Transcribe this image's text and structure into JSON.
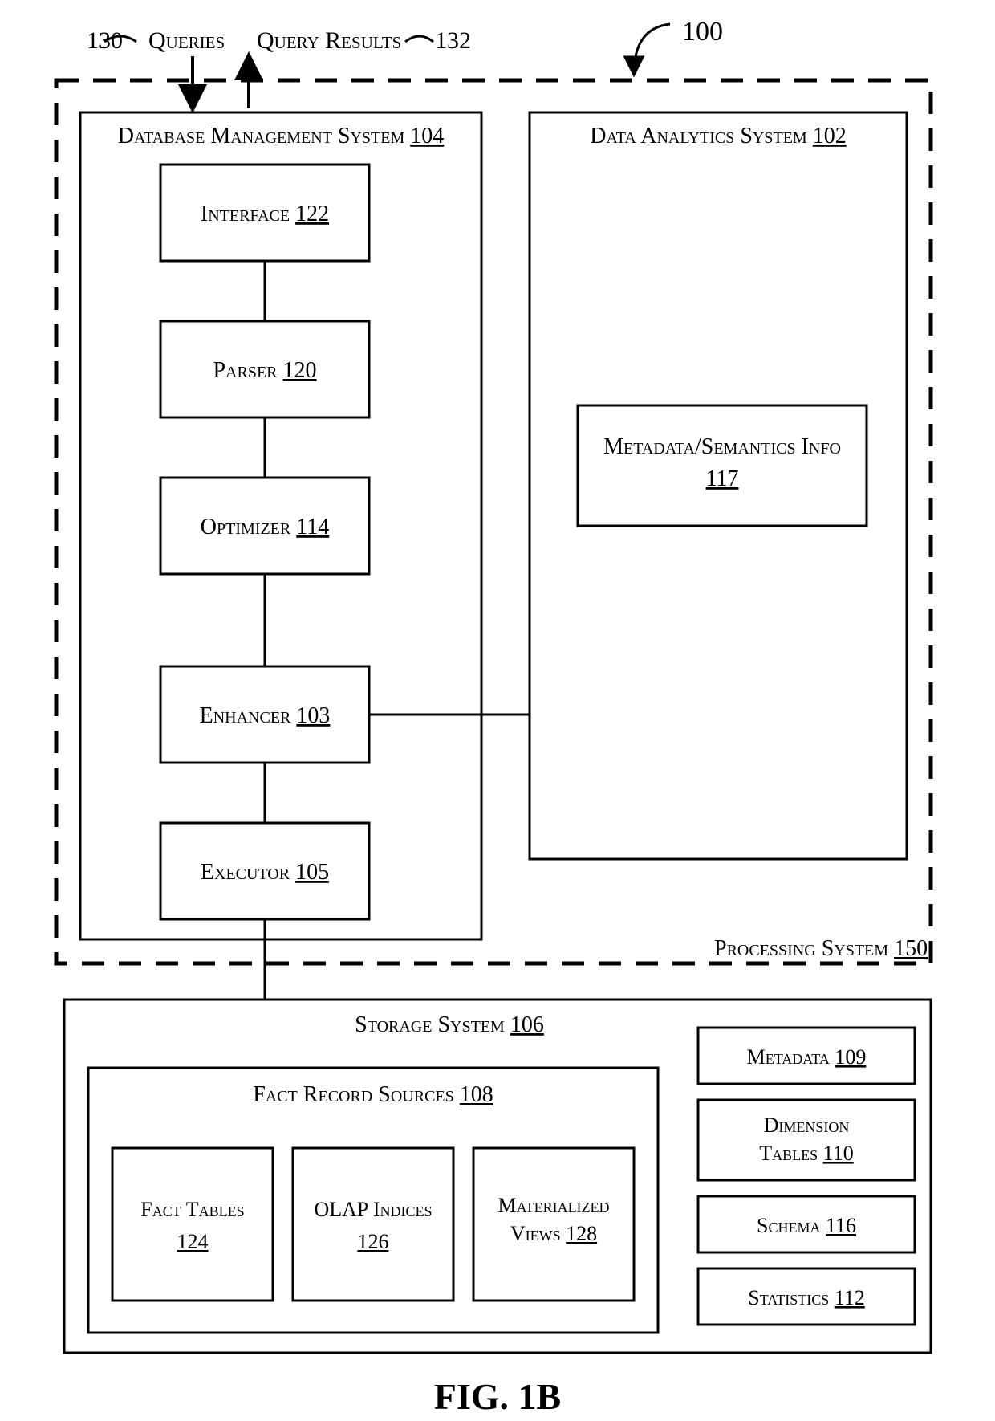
{
  "figureLabel": "FIG. 1B",
  "labels": {
    "top100": "100",
    "queries": "Queries",
    "queriesNum": "130",
    "results": "Query Results",
    "resultsNum": "132",
    "processingSystem": "Processing System",
    "processingSystemNum": "150",
    "dbms": "Database Management System",
    "dbmsNum": "104",
    "interface": "Interface",
    "interfaceNum": "122",
    "parser": "Parser",
    "parserNum": "120",
    "optimizer": "Optimizer",
    "optimizerNum": "114",
    "enhancer": "Enhancer",
    "enhancerNum": "103",
    "executor": "Executor",
    "executorNum": "105",
    "analytics": "Data Analytics System",
    "analyticsNum": "102",
    "metaSem": "Metadata/Semantics Info",
    "metaSemNum": "117",
    "storage": "Storage System",
    "storageNum": "106",
    "factSources": "Fact Record Sources",
    "factSourcesNum": "108",
    "factTables": "Fact Tables",
    "factTablesNum": "124",
    "olap": "OLAP Indices",
    "olapNum": "126",
    "matViews": "Materialized Views",
    "matViewsNum": "128",
    "metadata": "Metadata",
    "metadataNum": "109",
    "dimTables": "Dimension Tables",
    "dimTablesNum": "110",
    "schema": "Schema",
    "schemaNum": "116",
    "stats": "Statistics",
    "statsNum": "112"
  }
}
